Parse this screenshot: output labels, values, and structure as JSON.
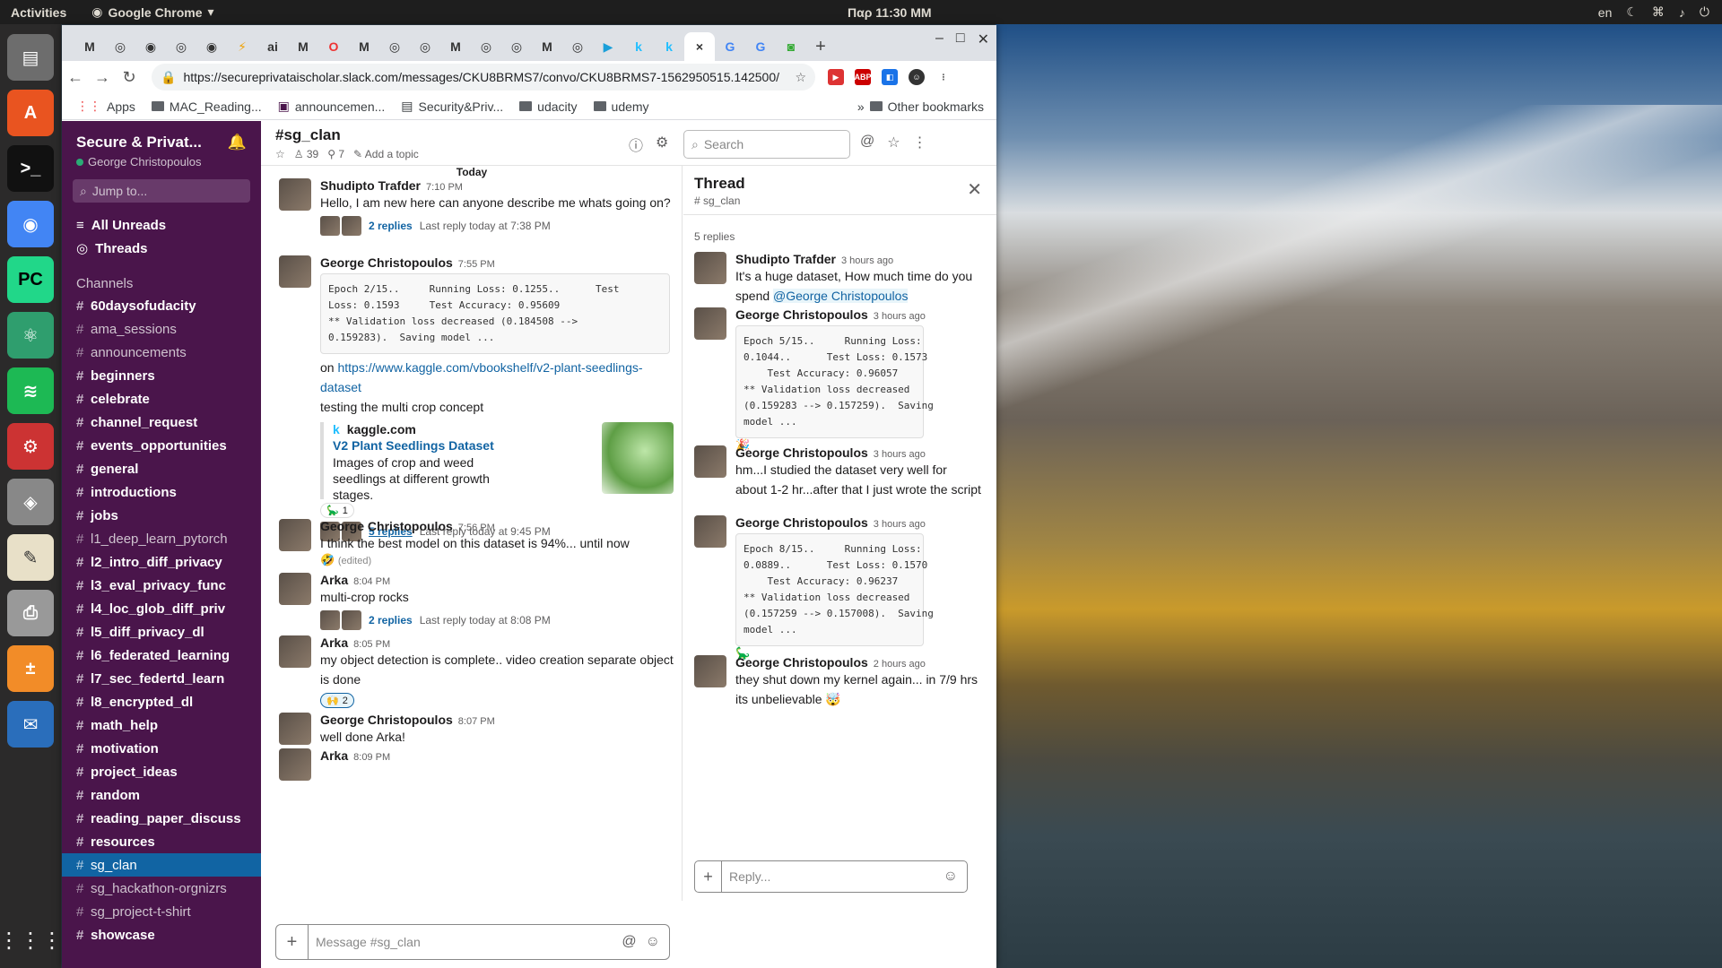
{
  "topbar": {
    "activities": "Activities",
    "app": "Google Chrome",
    "clock": "Παρ 11:30 ΜΜ",
    "lang": "en"
  },
  "browser": {
    "url": "https://secureprivataischolar.slack.com/messages/CKU8BRMS7/convo/CKU8BRMS7-1562950515.142500/",
    "tabs": [
      "M",
      "◎",
      "◉",
      "◎",
      "◉",
      "⚡",
      "ai",
      "M",
      "O",
      "M",
      "◎",
      "◎",
      "M",
      "◎",
      "◎",
      "M",
      "◎",
      "▶",
      "k",
      "k",
      "×",
      "G",
      "G",
      "◙"
    ],
    "bookmarks": [
      "Apps",
      "MAC_Reading...",
      "announcemen...",
      "Security&Priv...",
      "udacity",
      "udemy"
    ],
    "other_bookmarks": "Other bookmarks"
  },
  "sidebar": {
    "workspace": "Secure & Privat...",
    "user": "George Christopoulos",
    "jump": "Jump to...",
    "nav": [
      "All Unreads",
      "Threads"
    ],
    "channels_header": "Channels",
    "channels": [
      {
        "name": "60daysofudacity",
        "bold": true
      },
      {
        "name": "ama_sessions",
        "bold": false
      },
      {
        "name": "announcements",
        "bold": false
      },
      {
        "name": "beginners",
        "bold": true
      },
      {
        "name": "celebrate",
        "bold": true
      },
      {
        "name": "channel_request",
        "bold": true
      },
      {
        "name": "events_opportunities",
        "bold": true
      },
      {
        "name": "general",
        "bold": true
      },
      {
        "name": "introductions",
        "bold": true
      },
      {
        "name": "jobs",
        "bold": true
      },
      {
        "name": "l1_deep_learn_pytorch",
        "bold": false
      },
      {
        "name": "l2_intro_diff_privacy",
        "bold": true
      },
      {
        "name": "l3_eval_privacy_func",
        "bold": true
      },
      {
        "name": "l4_loc_glob_diff_priv",
        "bold": true
      },
      {
        "name": "l5_diff_privacy_dl",
        "bold": true
      },
      {
        "name": "l6_federated_learning",
        "bold": true
      },
      {
        "name": "l7_sec_federtd_learn",
        "bold": true
      },
      {
        "name": "l8_encrypted_dl",
        "bold": true
      },
      {
        "name": "math_help",
        "bold": true
      },
      {
        "name": "motivation",
        "bold": true
      },
      {
        "name": "project_ideas",
        "bold": true
      },
      {
        "name": "random",
        "bold": true
      },
      {
        "name": "reading_paper_discuss",
        "bold": true
      },
      {
        "name": "resources",
        "bold": true
      },
      {
        "name": "sg_clan",
        "bold": false,
        "selected": true
      },
      {
        "name": "sg_hackathon-orgnizrs",
        "bold": false
      },
      {
        "name": "sg_project-t-shirt",
        "bold": false
      },
      {
        "name": "showcase",
        "bold": true
      }
    ]
  },
  "channel": {
    "title": "#sg_clan",
    "members": "39",
    "pins": "7",
    "topic": "Add a topic",
    "search_placeholder": "Search",
    "today": "Today"
  },
  "messages": {
    "m1": {
      "name": "Shudipto Trafder",
      "time": "7:10 PM",
      "text": "Hello, I am new here can anyone describe me whats going on?",
      "replies": "2 replies",
      "last": "Last reply today at 7:38 PM"
    },
    "m2": {
      "name": "George Christopoulos",
      "time": "7:55 PM",
      "code": "Epoch 2/15..     Running Loss: 0.1255..      Test\nLoss: 0.1593     Test Accuracy: 0.95609\n** Validation loss decreased (0.184508 -->\n0.159283).  Saving model ...",
      "on": "on ",
      "link": "https://www.kaggle.com/vbookshelf/v2-plant-seedlings-dataset",
      "text2": "testing the multi crop concept",
      "site": "kaggle.com",
      "ptitle": "V2 Plant Seedlings Dataset",
      "pdesc": "Images of crop and weed seedlings at different growth stages.",
      "react": "1",
      "replies": "5 replies",
      "last": "Last reply today at 9:45 PM"
    },
    "m3": {
      "name": "George Christopoulos",
      "time": "7:56 PM",
      "text": "I think the best model on this dataset is 94%... until now",
      "edited": "(edited)"
    },
    "m4": {
      "name": "Arka",
      "time": "8:04 PM",
      "text": "multi-crop rocks",
      "replies": "2 replies",
      "last": "Last reply today at 8:08 PM"
    },
    "m5": {
      "name": "Arka",
      "time": "8:05 PM",
      "text": "my object detection is complete.. video creation separate object is done",
      "react": "2"
    },
    "m6": {
      "name": "George Christopoulos",
      "time": "8:07 PM",
      "text": "well done Arka!"
    },
    "m7": {
      "name": "Arka",
      "time": "8:09 PM"
    }
  },
  "composer": {
    "placeholder": "Message #sg_clan"
  },
  "thread": {
    "title": "Thread",
    "channel": "# sg_clan",
    "count": "5 replies",
    "t1": {
      "name": "Shudipto Trafder",
      "time": "3 hours ago",
      "text": "It's a huge dataset, How much time do you spend ",
      "mention": "@George Christopoulos"
    },
    "t2": {
      "name": "George Christopoulos",
      "time": "3 hours ago",
      "code": "Epoch 5/15..     Running Loss:\n0.1044..      Test Loss: 0.1573\n    Test Accuracy: 0.96057\n** Validation loss decreased\n(0.159283 --> 0.157259).  Saving\nmodel ..."
    },
    "t3": {
      "name": "George Christopoulos",
      "time": "3 hours ago",
      "text": "hm...I studied the dataset very well for about 1-2 hr...after that I just wrote the script"
    },
    "t4": {
      "name": "George Christopoulos",
      "time": "3 hours ago",
      "code": "Epoch 8/15..     Running Loss:\n0.0889..      Test Loss: 0.1570\n    Test Accuracy: 0.96237\n** Validation loss decreased\n(0.157259 --> 0.157008).  Saving\nmodel ..."
    },
    "t5": {
      "name": "George Christopoulos",
      "time": "2 hours ago",
      "text1": "they shut down my kernel again... in 7/9 hrs",
      "text2": "its unbelievable 🤯"
    },
    "reply_placeholder": "Reply..."
  }
}
